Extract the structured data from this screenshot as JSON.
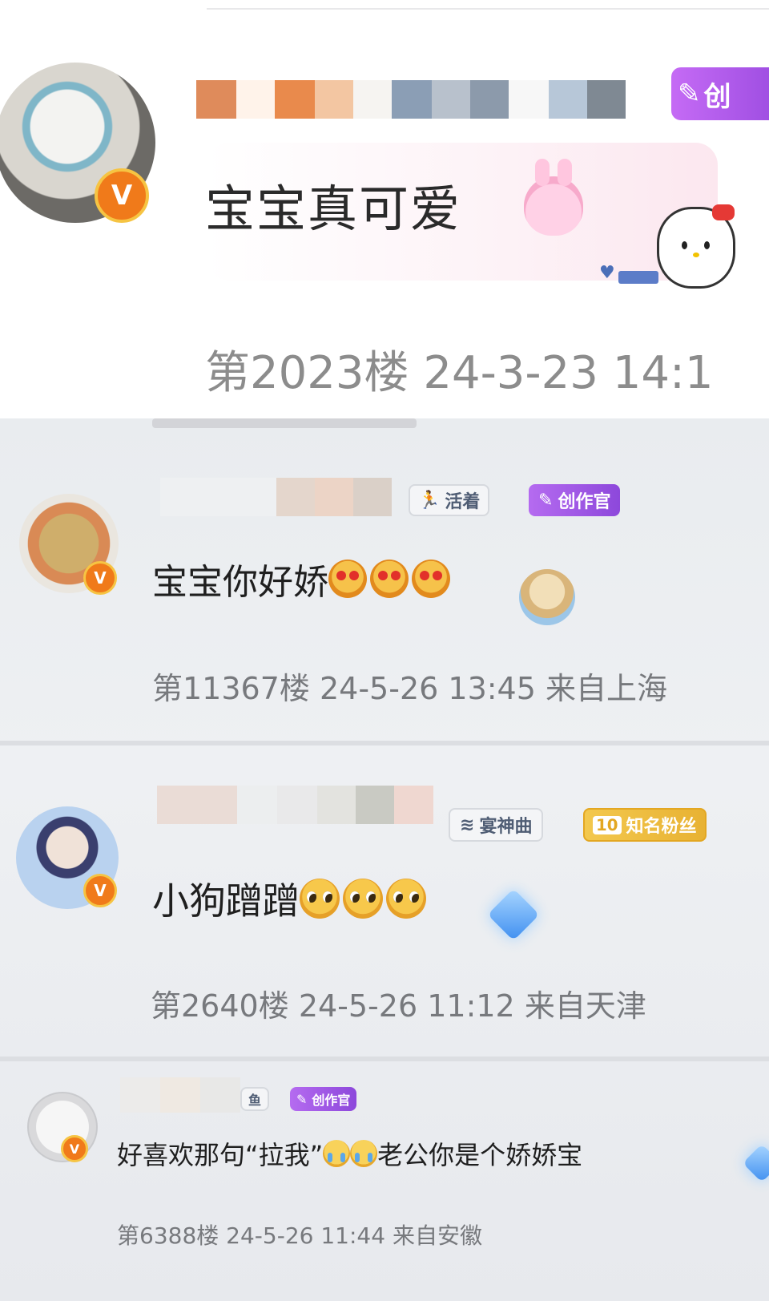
{
  "top_comment": {
    "text": "宝宝真可爱",
    "floor": "第2023楼",
    "date": "24-3-23",
    "time": "14:1",
    "badge_label": "创",
    "verified_mark": "V",
    "emoji": [
      "bunny-emoji"
    ],
    "sticker": "hello-kitty-sticker"
  },
  "comments": [
    {
      "text": "宝宝你好娇",
      "floor": "第11367楼",
      "date": "24-5-26",
      "time": "13:45",
      "location": "来自上海",
      "verified_mark": "V",
      "tags": [
        {
          "label": "活着",
          "icon": "runner-icon",
          "style": "plain"
        },
        {
          "label": "创作官",
          "icon": "pen-icon",
          "style": "purple"
        }
      ],
      "emoji": [
        "heart-eyes-emoji",
        "heart-eyes-emoji",
        "heart-eyes-emoji"
      ]
    },
    {
      "text": "小狗蹭蹭",
      "floor": "第2640楼",
      "date": "24-5-26",
      "time": "11:12",
      "location": "来自天津",
      "verified_mark": "V",
      "tags": [
        {
          "label": "宴神曲",
          "icon": "wave-icon",
          "style": "plain"
        },
        {
          "label": "知名粉丝",
          "level": "10",
          "style": "gold"
        }
      ],
      "emoji": [
        "pleading-emoji",
        "pleading-emoji",
        "pleading-emoji"
      ]
    },
    {
      "text_before": "好喜欢那句“拉我”",
      "text_after": "老公你是个娇娇宝",
      "floor": "第6388楼",
      "date": "24-5-26",
      "time": "11:44",
      "location": "来自安徽",
      "verified_mark": "V",
      "tags": [
        {
          "label": "鱼",
          "style": "plain"
        },
        {
          "label": "创作官",
          "icon": "pen-icon",
          "style": "purple"
        }
      ],
      "emoji": [
        "crying-emoji",
        "crying-emoji"
      ]
    }
  ],
  "colors": {
    "creator_purple": "#9b4be0",
    "verified_orange": "#f07a1a",
    "fan_gold": "#e8b233",
    "meta_gray": "#8c8c8c"
  }
}
